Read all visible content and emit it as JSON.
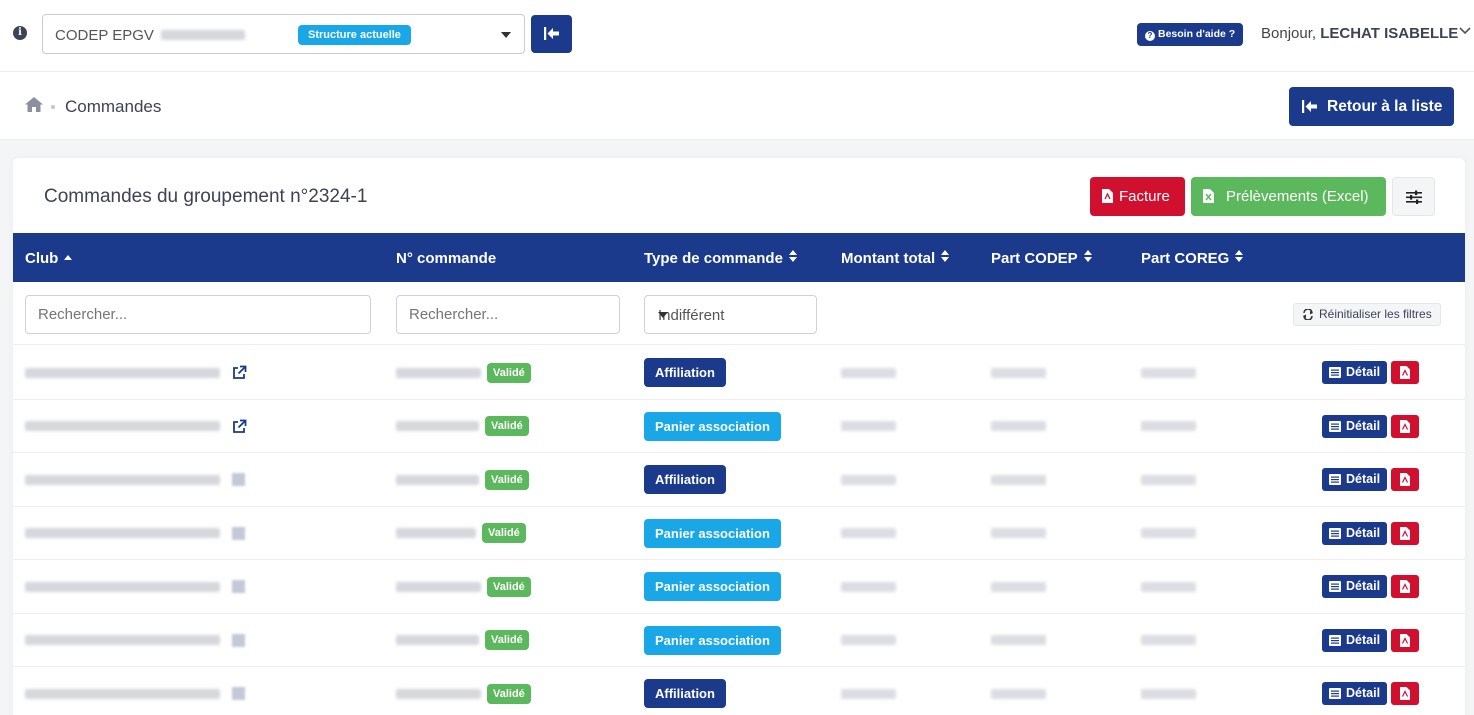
{
  "topbar": {
    "structure_name": "CODEP EPGV",
    "structure_badge": "Structure actuelle",
    "help_label": "Besoin d'aide ?",
    "greeting_prefix": "Bonjour,",
    "user_name": "LECHAT ISABELLE"
  },
  "breadcrumb": {
    "title": "Commandes",
    "back_label": "Retour à la liste"
  },
  "card": {
    "title": "Commandes du groupement n°2324-1",
    "facture_label": "Facture",
    "excel_label": "Prélèvements (Excel)"
  },
  "table": {
    "columns": [
      "Club",
      "N° commande",
      "Type de commande",
      "Montant total",
      "Part CODEP",
      "Part COREG"
    ],
    "filters": {
      "club_placeholder": "Rechercher...",
      "num_placeholder": "Rechercher...",
      "type_selected": "Indifférent",
      "reset_label": "Réinitialiser les filtres"
    },
    "detail_label": "Détail",
    "rows": [
      {
        "status": "Validé",
        "type": "Affiliation",
        "type_kind": "aff"
      },
      {
        "status": "Validé",
        "type": "Panier association",
        "type_kind": "pan"
      },
      {
        "status": "Validé",
        "type": "Affiliation",
        "type_kind": "aff"
      },
      {
        "status": "Validé",
        "type": "Panier association",
        "type_kind": "pan"
      },
      {
        "status": "Validé",
        "type": "Panier association",
        "type_kind": "pan"
      },
      {
        "status": "Validé",
        "type": "Panier association",
        "type_kind": "pan"
      },
      {
        "status": "Validé",
        "type": "Affiliation",
        "type_kind": "aff"
      }
    ]
  },
  "colors": {
    "primary": "#1b3a8c",
    "info": "#19a7e8",
    "success": "#5cb85c",
    "danger": "#d0102e"
  }
}
